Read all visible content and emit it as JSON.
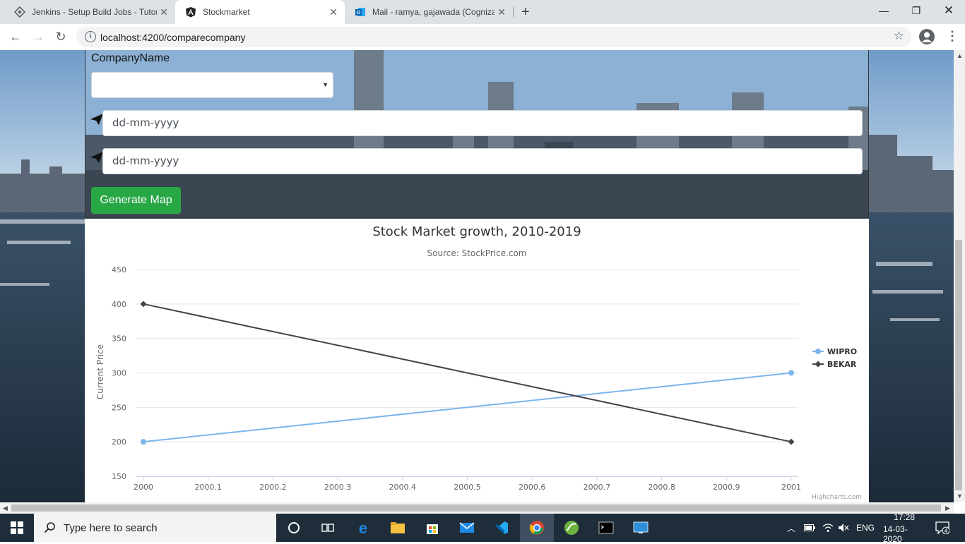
{
  "browser": {
    "tabs": [
      {
        "title": "Jenkins - Setup Build Jobs - Tutor",
        "active": false
      },
      {
        "title": "Stockmarket",
        "active": true
      },
      {
        "title": "Mail - ramya, gajawada (Cognizan",
        "active": false
      }
    ],
    "url": "localhost:4200/comparecompany"
  },
  "form": {
    "company_label": "CompanyName",
    "company_value": "",
    "date_placeholder_1": "dd-mm-yyyy",
    "date_placeholder_2": "dd-mm-yyyy",
    "generate_button": "Generate Map"
  },
  "chart_data": {
    "type": "line",
    "title": "Stock Market growth, 2010-2019",
    "subtitle": "Source: StockPrice.com",
    "ylabel": "Current Price",
    "xlabel": "",
    "x_ticks": [
      "2000",
      "2000.1",
      "2000.2",
      "2000.3",
      "2000.4",
      "2000.5",
      "2000.6",
      "2000.7",
      "2000.8",
      "2000.9",
      "2001"
    ],
    "y_ticks": [
      "150",
      "200",
      "250",
      "300",
      "350",
      "400",
      "450"
    ],
    "xlim": [
      2000,
      2001
    ],
    "ylim": [
      150,
      450
    ],
    "grid": true,
    "legend_position": "right",
    "credits": "Highcharts.com",
    "series": [
      {
        "name": "WIPRO",
        "color": "#7cb5ec",
        "marker": "circle",
        "x": [
          2000,
          2001
        ],
        "y": [
          200,
          300
        ]
      },
      {
        "name": "BEKAR",
        "color": "#434348",
        "marker": "diamond",
        "x": [
          2000,
          2001
        ],
        "y": [
          400,
          200
        ]
      }
    ]
  },
  "taskbar": {
    "search_placeholder": "Type here to search",
    "language": "ENG",
    "time": "17:28",
    "date": "14-03-2020",
    "notification_count": "4"
  }
}
